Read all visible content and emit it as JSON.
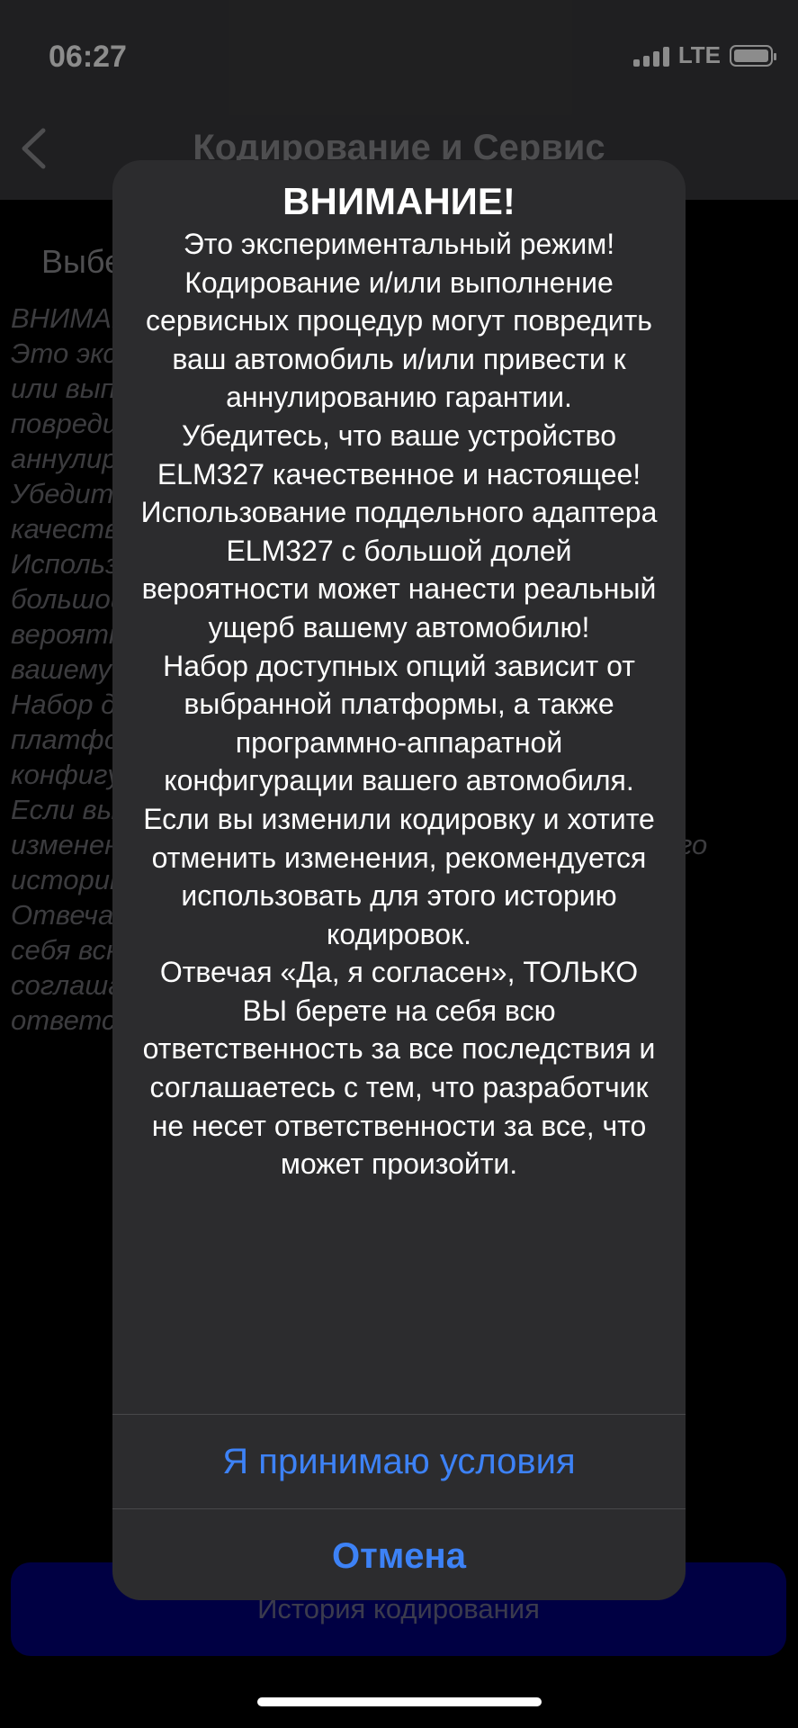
{
  "status_bar": {
    "time": "06:27",
    "network": "LTE"
  },
  "nav": {
    "title": "Кодирование и Сервис"
  },
  "background": {
    "heading": "Выберите",
    "text_lines": [
      "ВНИМАНИЕ!",
      "Это экспериментальный режим! Кодирование и/",
      "или выполнение сервисных процедур могут",
      "повредить ваш автомобиль и/или привести к",
      "аннулированию гарантии.",
      "Убедитесь, что ваше устройство ELM327",
      "качественное и настоящее!",
      "Использование поддельного адаптера ELM327 с большой долей",
      "вероятности может нанести реальный ущерб",
      "вашему автомобилю!",
      "Набор доступных опций зависит от выбранной",
      "платформы, а также программно-аппаратной",
      "конфигурации вашего автомобиля.",
      "Если вы изменили кодировку и хотите отменить",
      "изменения, рекомендуется использовать для этого",
      "историю кодировок.",
      "Отвечая «Да, я согласен», ТОЛЬКО ВЫ берете на",
      "себя всю ответственность за все последствия и",
      "соглашаетесь с тем, что разработчик не несет",
      "ответственности за все, что может произойти."
    ],
    "history_button": "История кодирования"
  },
  "alert": {
    "title": "ВНИМАНИЕ!",
    "message": "Это экспериментальный режим! Кодирование и/или выполнение сервисных процедур могут повредить ваш автомобиль и/или привести к аннулированию гарантии.\nУбедитесь, что ваше устройство ELM327 качественное и настоящее! Использование поддельного адаптера ELM327 с большой долей вероятности может нанести реальный ущерб вашему автомобилю!\nНабор доступных опций зависит от выбранной платформы, а также программно-аппаратной конфигурации вашего автомобиля.\nЕсли вы изменили кодировку и хотите отменить изменения, рекомендуется использовать для этого историю кодировок.\nОтвечая «Да, я согласен», ТОЛЬКО ВЫ берете на себя всю ответственность за все последствия и соглашаетесь с тем, что разработчик не несет ответственности за все, что может произойти.",
    "accept_label": "Я принимаю условия",
    "cancel_label": "Отмена"
  },
  "colors": {
    "accent": "#3d82f6",
    "alert_bg": "#2c2c2e",
    "history_button_bg": "#00007a"
  }
}
